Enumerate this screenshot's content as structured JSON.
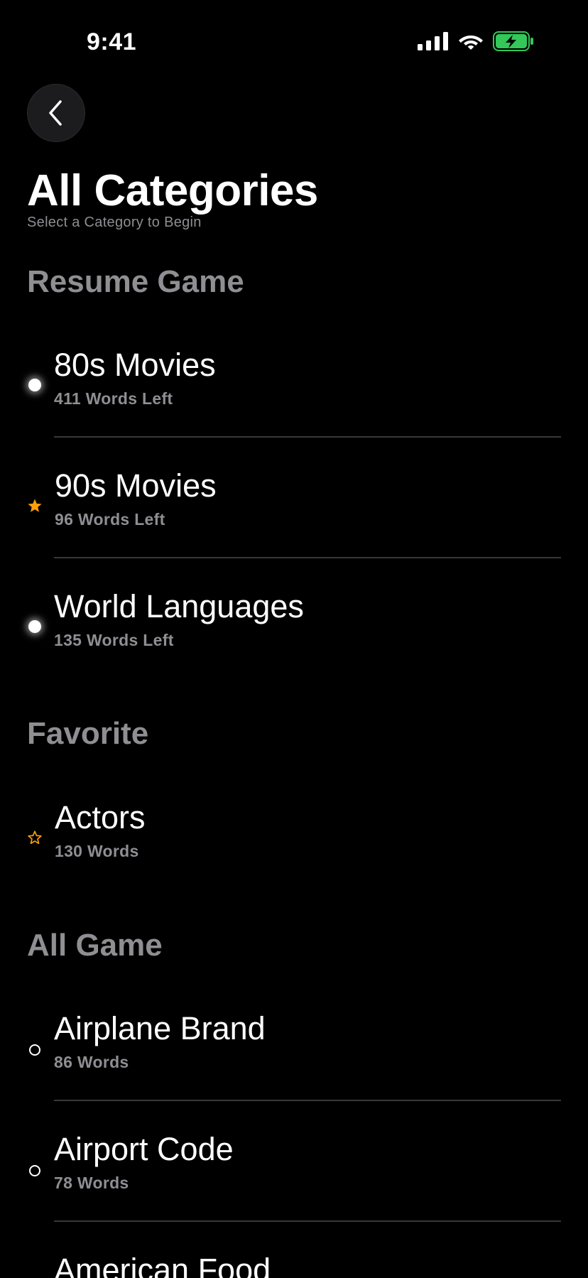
{
  "status_bar": {
    "time": "9:41",
    "icons": [
      "cellular-signal-icon",
      "wifi-icon",
      "battery-charging-icon"
    ],
    "battery_color": "#34c759"
  },
  "nav": {
    "back_icon": "chevron-left-icon"
  },
  "header": {
    "title": "All Categories",
    "subtitle": "Select a Category to Begin"
  },
  "sections": {
    "resume": {
      "title": "Resume Game",
      "items": [
        {
          "title": "80s Movies",
          "subtitle": "411 Words Left",
          "icon": "dot-filled-icon"
        },
        {
          "title": "90s Movies",
          "subtitle": "96 Words Left",
          "icon": "star-filled-icon"
        },
        {
          "title": "World Languages",
          "subtitle": "135 Words Left",
          "icon": "dot-filled-icon"
        }
      ]
    },
    "favorite": {
      "title": "Favorite",
      "items": [
        {
          "title": "Actors",
          "subtitle": "130 Words",
          "icon": "star-outline-icon"
        }
      ]
    },
    "all": {
      "title": "All Game",
      "items": [
        {
          "title": "Airplane Brand",
          "subtitle": "86 Words",
          "icon": "circle-outline-icon"
        },
        {
          "title": "Airport Code",
          "subtitle": "78 Words",
          "icon": "circle-outline-icon"
        },
        {
          "title": "American Food",
          "subtitle": "",
          "icon": "circle-outline-icon"
        }
      ]
    }
  },
  "colors": {
    "background": "#000000",
    "accent_star": "#ff9f0a",
    "secondary_text": "#8e8e93",
    "divider": "#38383a"
  }
}
